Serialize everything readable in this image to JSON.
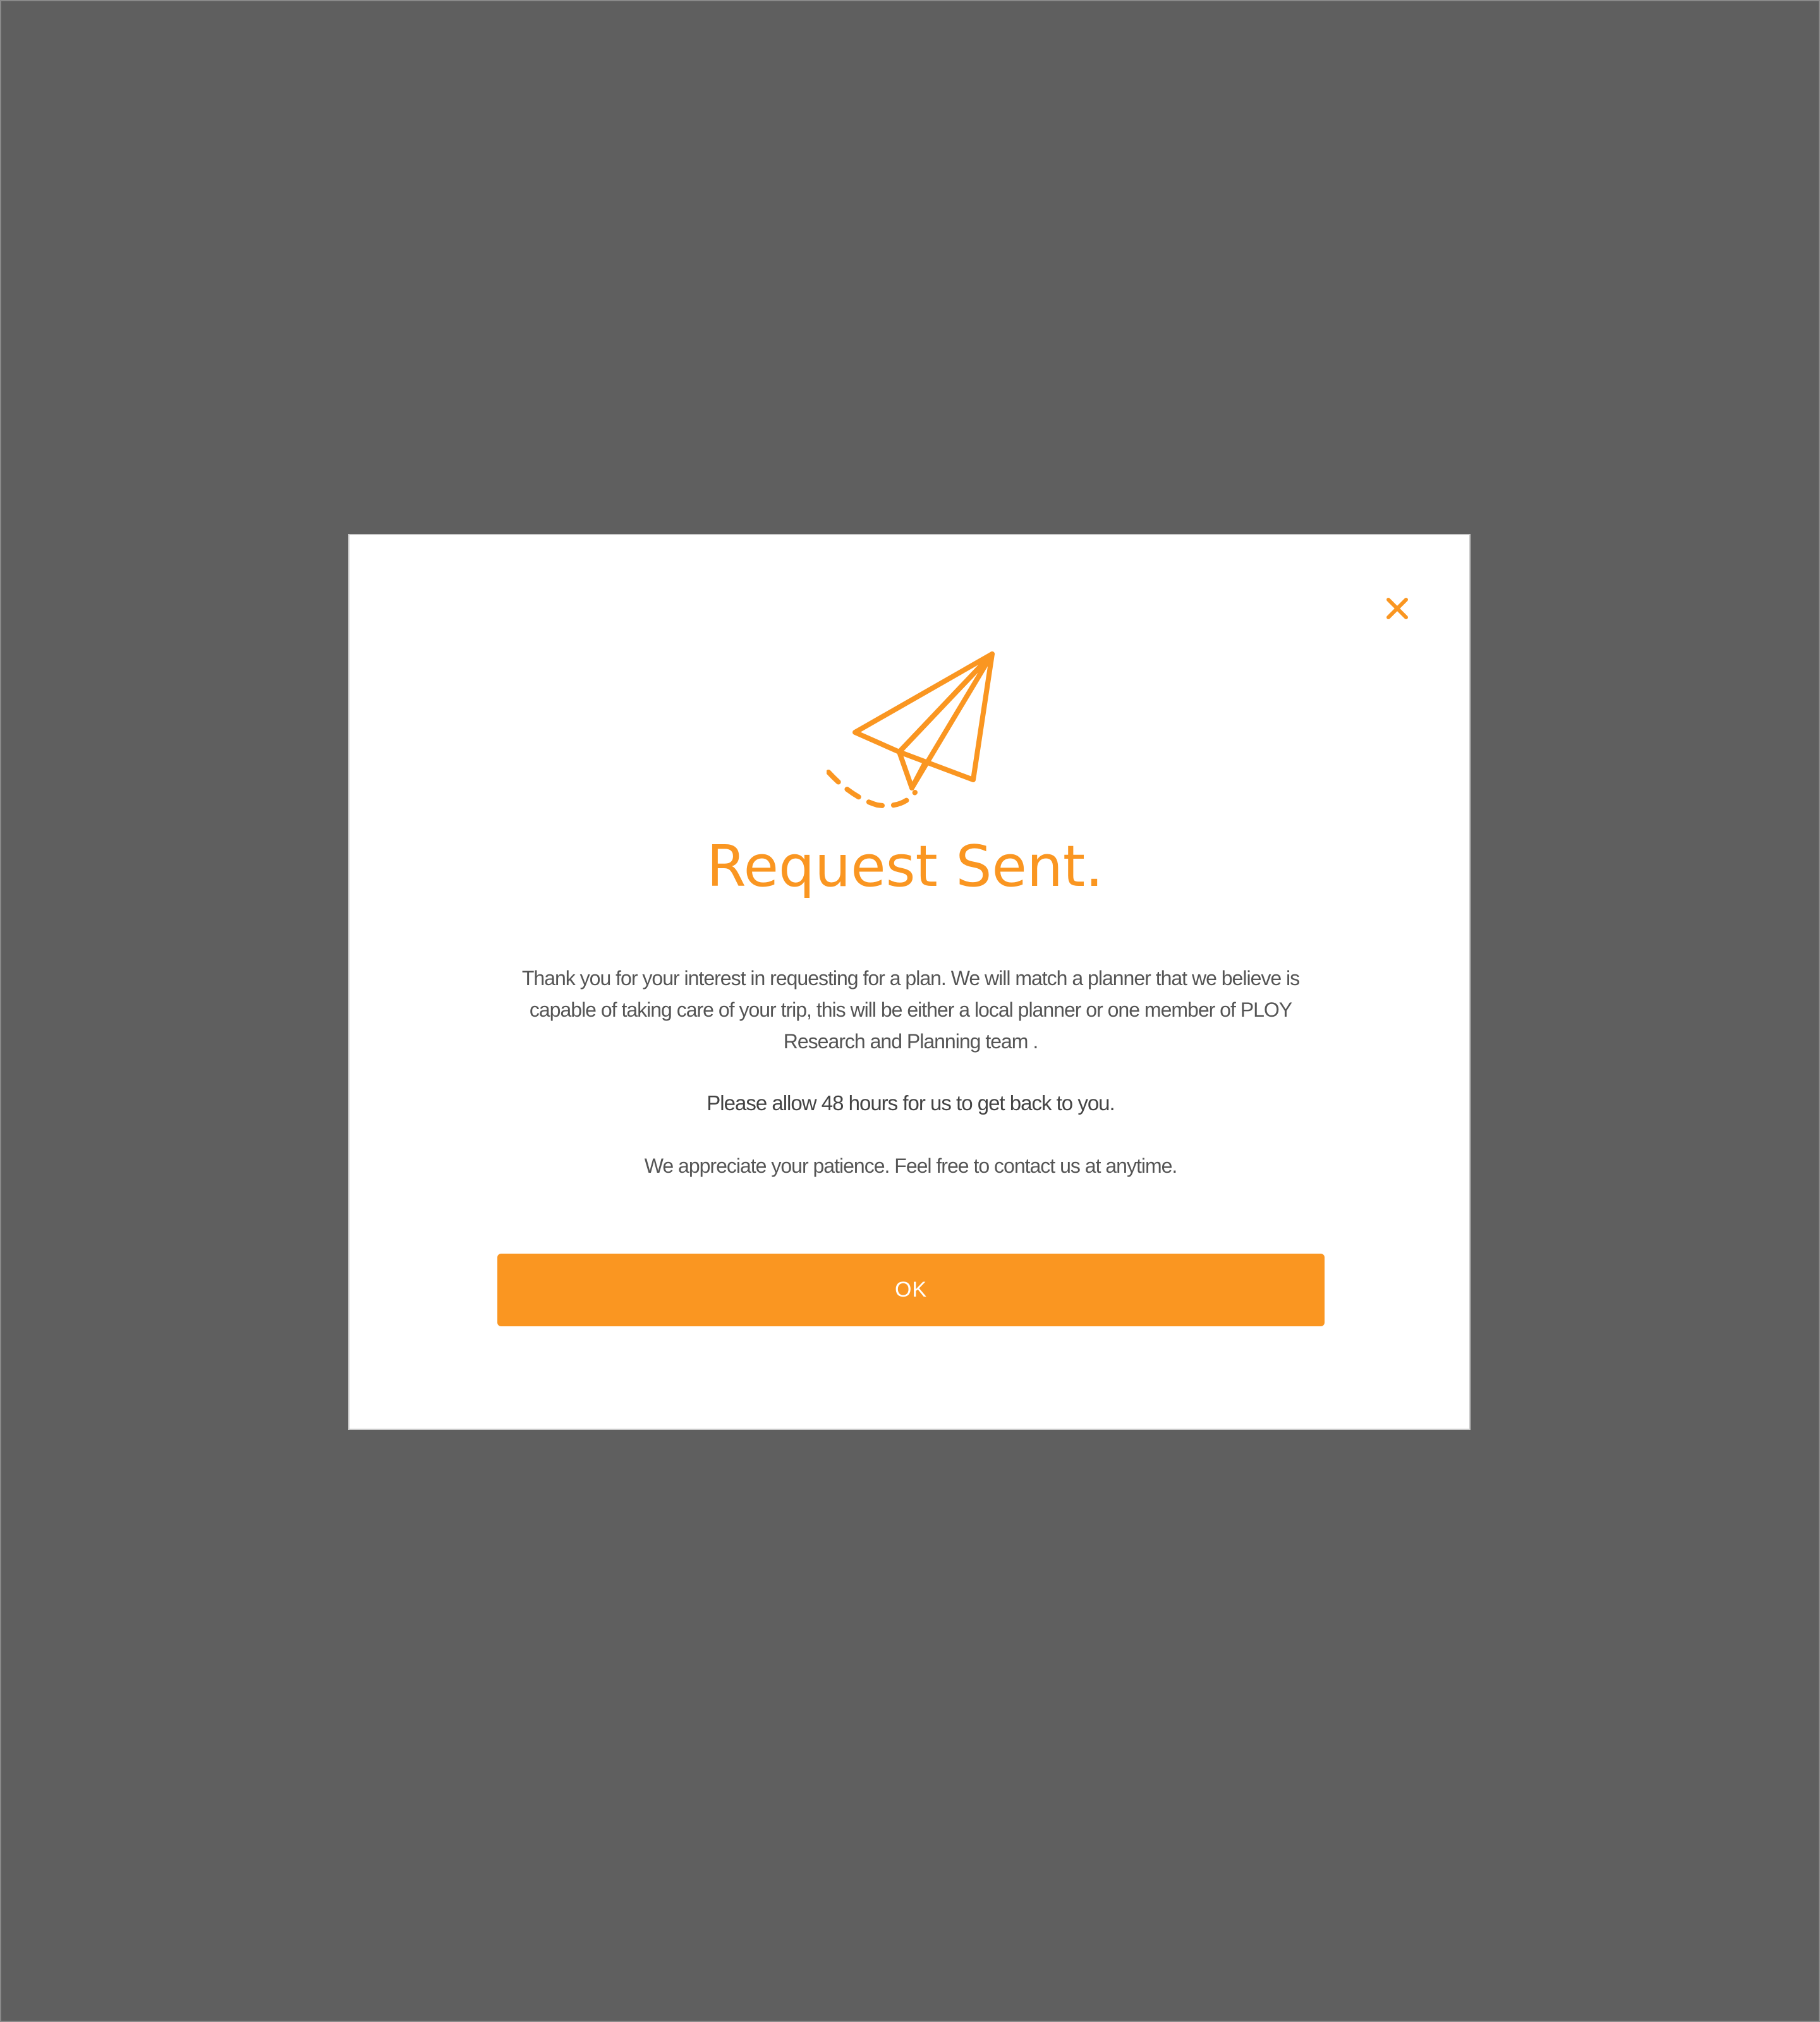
{
  "colors": {
    "overlay": "#5f5f5f",
    "accent": "#fa9621",
    "modal_background": "#ffffff",
    "body_text": "#555555",
    "button_text": "#ffffff"
  },
  "dialog": {
    "close_icon": "close-icon",
    "hero_icon": "paper-plane-icon",
    "title": "Request Sent.",
    "message": "Thank you for your interest in requesting for a plan. We will match a planner that we believe is capable of taking care of your trip, this will be either a local planner or one member of  PLOY Research and Planning team .",
    "notice": "Please allow 48 hours for us to get back to you.",
    "closing": "We appreciate your patience. Feel free to contact us at anytime.",
    "ok_label": "OK"
  }
}
